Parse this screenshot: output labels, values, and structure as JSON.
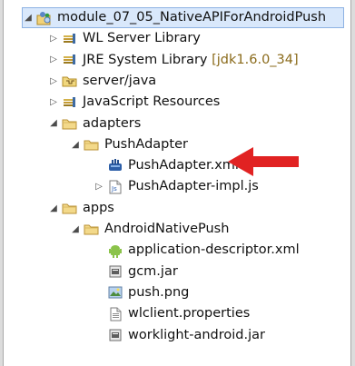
{
  "tree": {
    "root": {
      "label": "module_07_05_NativeAPIForAndroidPush",
      "icon": "project-icon"
    },
    "items": [
      {
        "label": "WL Server Library",
        "suffix": "",
        "icon": "library-icon"
      },
      {
        "label": "JRE System Library",
        "suffix": "[jdk1.6.0_34]",
        "icon": "library-icon"
      },
      {
        "label": "server/java",
        "suffix": "",
        "icon": "source-folder-icon"
      },
      {
        "label": "JavaScript Resources",
        "suffix": "",
        "icon": "library-icon"
      },
      {
        "label": "adapters",
        "suffix": "",
        "icon": "folder-icon"
      },
      {
        "label": "PushAdapter",
        "suffix": "",
        "icon": "folder-icon"
      },
      {
        "label": "PushAdapter.xml",
        "suffix": "",
        "icon": "adapter-xml-icon"
      },
      {
        "label": "PushAdapter-impl.js",
        "suffix": "",
        "icon": "js-file-icon"
      },
      {
        "label": "apps",
        "suffix": "",
        "icon": "folder-icon"
      },
      {
        "label": "AndroidNativePush",
        "suffix": "",
        "icon": "folder-icon"
      },
      {
        "label": "application-descriptor.xml",
        "suffix": "",
        "icon": "android-icon"
      },
      {
        "label": "gcm.jar",
        "suffix": "",
        "icon": "jar-file-icon"
      },
      {
        "label": "push.png",
        "suffix": "",
        "icon": "image-file-icon"
      },
      {
        "label": "wlclient.properties",
        "suffix": "",
        "icon": "text-file-icon"
      },
      {
        "label": "worklight-android.jar",
        "suffix": "",
        "icon": "jar-file-icon"
      }
    ]
  },
  "colors": {
    "selection": "#d9e8fb",
    "selection_border": "#8db2e3",
    "folder": "#e7c46a",
    "library": "#c3a12b",
    "arrow": "#e12222",
    "suffix": "#8a6a1a"
  }
}
